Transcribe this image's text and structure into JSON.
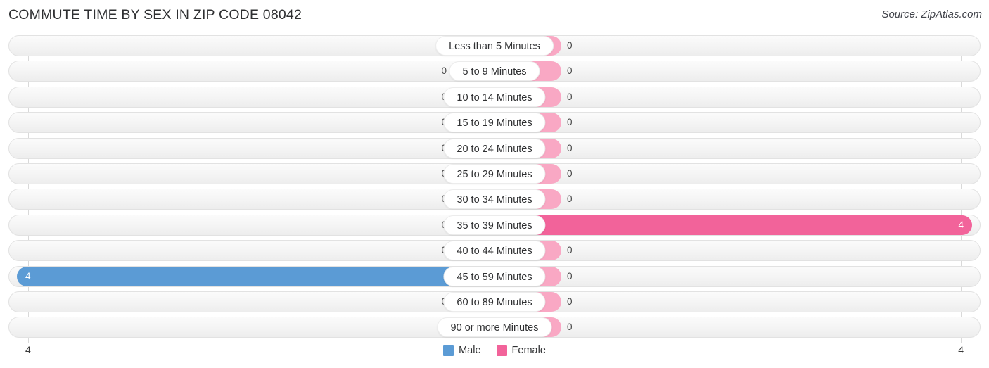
{
  "header": {
    "title": "COMMUTE TIME BY SEX IN ZIP CODE 08042",
    "source": "Source: ZipAtlas.com"
  },
  "legend": {
    "male_label": "Male",
    "female_label": "Female",
    "male_color": "#5b9bd5",
    "female_color": "#f2639a"
  },
  "axis": {
    "left_label": "4",
    "right_label": "4"
  },
  "colors": {
    "male_light": "#aecbeb",
    "male_strong": "#5b9bd5",
    "female_light": "#f9a8c4",
    "female_strong": "#f2639a",
    "track": "#f4f4f4"
  },
  "chart_data": {
    "type": "bar",
    "orientation": "horizontal-diverging",
    "title": "COMMUTE TIME BY SEX IN ZIP CODE 08042",
    "xlabel": "",
    "ylabel": "",
    "xlim": [
      4,
      4
    ],
    "grid": true,
    "legend_position": "bottom-center",
    "categories": [
      "Less than 5 Minutes",
      "5 to 9 Minutes",
      "10 to 14 Minutes",
      "15 to 19 Minutes",
      "20 to 24 Minutes",
      "25 to 29 Minutes",
      "30 to 34 Minutes",
      "35 to 39 Minutes",
      "40 to 44 Minutes",
      "45 to 59 Minutes",
      "60 to 89 Minutes",
      "90 or more Minutes"
    ],
    "series": [
      {
        "name": "Male",
        "values": [
          0,
          0,
          0,
          0,
          0,
          0,
          0,
          0,
          0,
          4,
          0,
          0
        ]
      },
      {
        "name": "Female",
        "values": [
          0,
          0,
          0,
          0,
          0,
          0,
          0,
          4,
          0,
          0,
          0,
          0
        ]
      }
    ]
  },
  "rows": [
    {
      "label": "Less than 5 Minutes",
      "male": "0",
      "female": "0",
      "male_w": 60,
      "female_w": 95,
      "male_hi": false,
      "female_hi": false
    },
    {
      "label": "5 to 9 Minutes",
      "male": "0",
      "female": "0",
      "male_w": 60,
      "female_w": 95,
      "male_hi": false,
      "female_hi": false
    },
    {
      "label": "10 to 14 Minutes",
      "male": "0",
      "female": "0",
      "male_w": 60,
      "female_w": 95,
      "male_hi": false,
      "female_hi": false
    },
    {
      "label": "15 to 19 Minutes",
      "male": "0",
      "female": "0",
      "male_w": 60,
      "female_w": 95,
      "male_hi": false,
      "female_hi": false
    },
    {
      "label": "20 to 24 Minutes",
      "male": "0",
      "female": "0",
      "male_w": 60,
      "female_w": 95,
      "male_hi": false,
      "female_hi": false
    },
    {
      "label": "25 to 29 Minutes",
      "male": "0",
      "female": "0",
      "male_w": 60,
      "female_w": 95,
      "male_hi": false,
      "female_hi": false
    },
    {
      "label": "30 to 34 Minutes",
      "male": "0",
      "female": "0",
      "male_w": 60,
      "female_w": 95,
      "male_hi": false,
      "female_hi": false
    },
    {
      "label": "35 to 39 Minutes",
      "male": "0",
      "female": "4",
      "male_w": 60,
      "female_w": 679,
      "male_hi": false,
      "female_hi": true
    },
    {
      "label": "40 to 44 Minutes",
      "male": "0",
      "female": "0",
      "male_w": 60,
      "female_w": 95,
      "male_hi": false,
      "female_hi": false
    },
    {
      "label": "45 to 59 Minutes",
      "male": "4",
      "female": "0",
      "male_w": 679,
      "female_w": 95,
      "male_hi": true,
      "female_hi": false
    },
    {
      "label": "60 to 89 Minutes",
      "male": "0",
      "female": "0",
      "male_w": 60,
      "female_w": 95,
      "male_hi": false,
      "female_hi": false
    },
    {
      "label": "90 or more Minutes",
      "male": "0",
      "female": "0",
      "male_w": 60,
      "female_w": 95,
      "male_hi": false,
      "female_hi": false
    }
  ]
}
